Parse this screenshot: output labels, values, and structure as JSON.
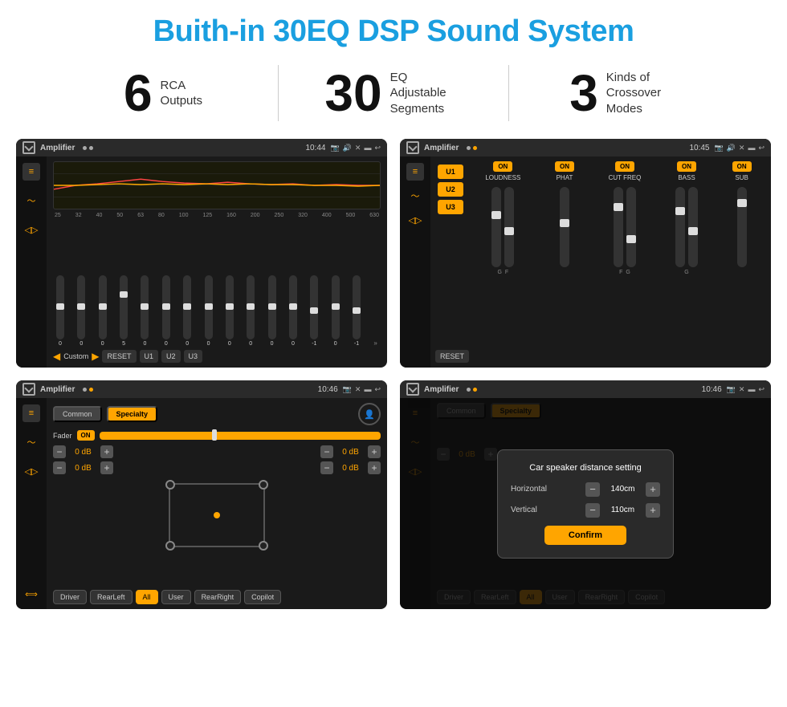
{
  "page": {
    "title": "Buith-in 30EQ DSP Sound System",
    "bg": "#ffffff"
  },
  "stats": [
    {
      "number": "6",
      "label": "RCA\nOutputs"
    },
    {
      "number": "30",
      "label": "EQ Adjustable\nSegments"
    },
    {
      "number": "3",
      "label": "Kinds of\nCrossover Modes"
    }
  ],
  "screens": [
    {
      "id": "screen1",
      "title": "Amplifier",
      "time": "10:44",
      "type": "eq",
      "eq_labels": [
        "25",
        "32",
        "40",
        "50",
        "63",
        "80",
        "100",
        "125",
        "160",
        "200",
        "250",
        "320",
        "400",
        "500",
        "630"
      ],
      "eq_values": [
        "0",
        "0",
        "0",
        "5",
        "0",
        "0",
        "0",
        "0",
        "0",
        "0",
        "0",
        "0",
        "-1",
        "0",
        "-1"
      ],
      "preset_label": "Custom",
      "buttons": [
        "RESET",
        "U1",
        "U2",
        "U3"
      ]
    },
    {
      "id": "screen2",
      "title": "Amplifier",
      "time": "10:45",
      "type": "crossover",
      "presets": [
        "U1",
        "U2",
        "U3"
      ],
      "channels": [
        "LOUDNESS",
        "PHAT",
        "CUT FREQ",
        "BASS",
        "SUB"
      ],
      "toggles": [
        "ON",
        "ON",
        "ON",
        "ON",
        "ON"
      ]
    },
    {
      "id": "screen3",
      "title": "Amplifier",
      "time": "10:46",
      "type": "fader",
      "tabs": [
        "Common",
        "Specialty"
      ],
      "fader_label": "Fader",
      "fader_toggle": "ON",
      "db_values": [
        "0 dB",
        "0 dB",
        "0 dB",
        "0 dB"
      ],
      "bottom_buttons": [
        "Driver",
        "RearLeft",
        "All",
        "User",
        "RearRight",
        "Copilot"
      ]
    },
    {
      "id": "screen4",
      "title": "Amplifier",
      "time": "10:46",
      "type": "dialog",
      "tabs": [
        "Common",
        "Specialty"
      ],
      "dialog_title": "Car speaker distance setting",
      "horizontal_label": "Horizontal",
      "horizontal_value": "140cm",
      "vertical_label": "Vertical",
      "vertical_value": "110cm",
      "confirm_label": "Confirm",
      "db_values": [
        "0 dB",
        "0 dB"
      ],
      "bottom_buttons": [
        "Driver",
        "RearLeft",
        "All",
        "User",
        "RearRight",
        "Copilot"
      ]
    }
  ]
}
